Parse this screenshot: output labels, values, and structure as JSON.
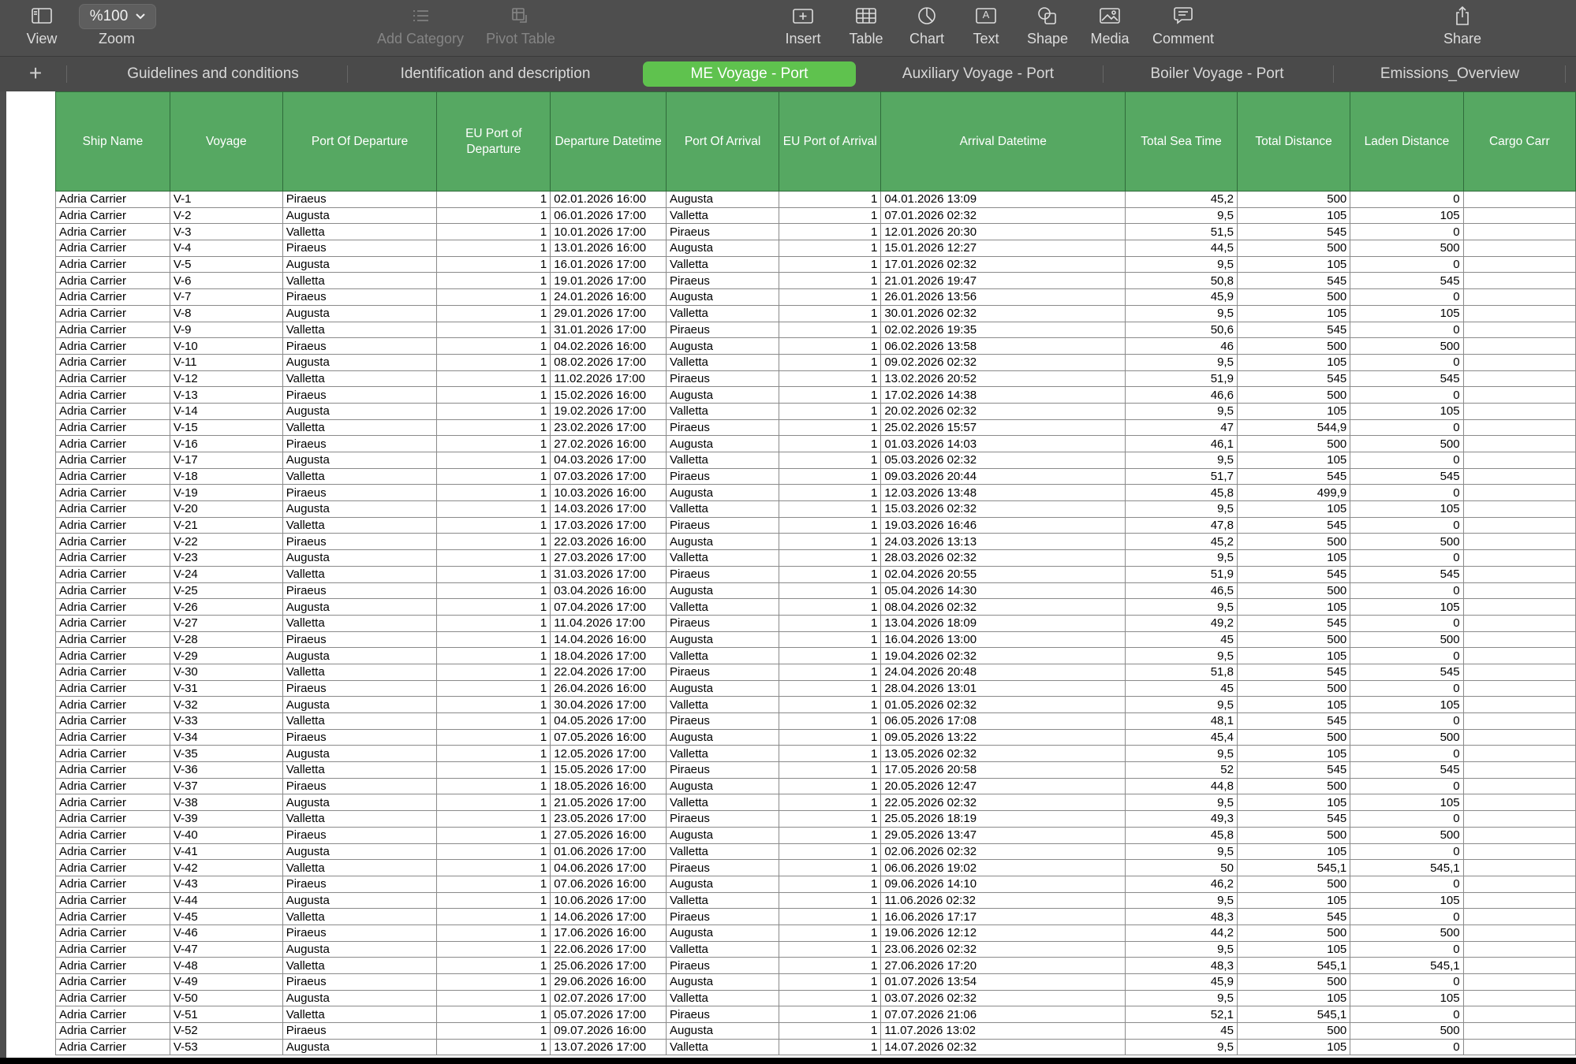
{
  "toolbar": {
    "view": "View",
    "zoom_label": "Zoom",
    "zoom_value": "%100",
    "add_category": "Add Category",
    "pivot_table": "Pivot Table",
    "insert": "Insert",
    "table": "Table",
    "chart": "Chart",
    "text": "Text",
    "text_icon_glyph": "A",
    "shape": "Shape",
    "media": "Media",
    "comment": "Comment",
    "share": "Share"
  },
  "tabs": [
    {
      "label": "Guidelines and conditions",
      "active": false
    },
    {
      "label": "Identification and description",
      "active": false
    },
    {
      "label": "ME Voyage - Port",
      "active": true
    },
    {
      "label": "Auxiliary Voyage - Port",
      "active": false
    },
    {
      "label": "Boiler Voyage - Port",
      "active": false
    },
    {
      "label": "Emissions_Overview",
      "active": false
    }
  ],
  "add_sheet": "+",
  "colors": {
    "header_green": "#56a862",
    "active_tab": "#5fc24e",
    "toolbar": "#4e4e4e"
  },
  "table": {
    "columns": [
      "Ship Name",
      "Voyage",
      "Port Of Departure",
      "EU Port of Departure",
      "Departure Datetime",
      "Port Of Arrival",
      "EU Port of Arrival",
      "Arrival Datetime",
      "Total Sea Time",
      "Total Distance",
      "Laden Distance",
      "Cargo Carr"
    ],
    "rows": [
      [
        "Adria Carrier",
        "V-1",
        "Piraeus",
        "1",
        "02.01.2026 16:00",
        "Augusta",
        "1",
        "04.01.2026 13:09",
        "45,2",
        "500",
        "0",
        ""
      ],
      [
        "Adria Carrier",
        "V-2",
        "Augusta",
        "1",
        "06.01.2026 17:00",
        "Valletta",
        "1",
        "07.01.2026 02:32",
        "9,5",
        "105",
        "105",
        ""
      ],
      [
        "Adria Carrier",
        "V-3",
        "Valletta",
        "1",
        "10.01.2026 17:00",
        "Piraeus",
        "1",
        "12.01.2026 20:30",
        "51,5",
        "545",
        "0",
        ""
      ],
      [
        "Adria Carrier",
        "V-4",
        "Piraeus",
        "1",
        "13.01.2026 16:00",
        "Augusta",
        "1",
        "15.01.2026 12:27",
        "44,5",
        "500",
        "500",
        ""
      ],
      [
        "Adria Carrier",
        "V-5",
        "Augusta",
        "1",
        "16.01.2026 17:00",
        "Valletta",
        "1",
        "17.01.2026 02:32",
        "9,5",
        "105",
        "0",
        ""
      ],
      [
        "Adria Carrier",
        "V-6",
        "Valletta",
        "1",
        "19.01.2026 17:00",
        "Piraeus",
        "1",
        "21.01.2026 19:47",
        "50,8",
        "545",
        "545",
        ""
      ],
      [
        "Adria Carrier",
        "V-7",
        "Piraeus",
        "1",
        "24.01.2026 16:00",
        "Augusta",
        "1",
        "26.01.2026 13:56",
        "45,9",
        "500",
        "0",
        ""
      ],
      [
        "Adria Carrier",
        "V-8",
        "Augusta",
        "1",
        "29.01.2026 17:00",
        "Valletta",
        "1",
        "30.01.2026 02:32",
        "9,5",
        "105",
        "105",
        ""
      ],
      [
        "Adria Carrier",
        "V-9",
        "Valletta",
        "1",
        "31.01.2026 17:00",
        "Piraeus",
        "1",
        "02.02.2026 19:35",
        "50,6",
        "545",
        "0",
        ""
      ],
      [
        "Adria Carrier",
        "V-10",
        "Piraeus",
        "1",
        "04.02.2026 16:00",
        "Augusta",
        "1",
        "06.02.2026 13:58",
        "46",
        "500",
        "500",
        ""
      ],
      [
        "Adria Carrier",
        "V-11",
        "Augusta",
        "1",
        "08.02.2026 17:00",
        "Valletta",
        "1",
        "09.02.2026 02:32",
        "9,5",
        "105",
        "0",
        ""
      ],
      [
        "Adria Carrier",
        "V-12",
        "Valletta",
        "1",
        "11.02.2026 17:00",
        "Piraeus",
        "1",
        "13.02.2026 20:52",
        "51,9",
        "545",
        "545",
        ""
      ],
      [
        "Adria Carrier",
        "V-13",
        "Piraeus",
        "1",
        "15.02.2026 16:00",
        "Augusta",
        "1",
        "17.02.2026 14:38",
        "46,6",
        "500",
        "0",
        ""
      ],
      [
        "Adria Carrier",
        "V-14",
        "Augusta",
        "1",
        "19.02.2026 17:00",
        "Valletta",
        "1",
        "20.02.2026 02:32",
        "9,5",
        "105",
        "105",
        ""
      ],
      [
        "Adria Carrier",
        "V-15",
        "Valletta",
        "1",
        "23.02.2026 17:00",
        "Piraeus",
        "1",
        "25.02.2026 15:57",
        "47",
        "544,9",
        "0",
        ""
      ],
      [
        "Adria Carrier",
        "V-16",
        "Piraeus",
        "1",
        "27.02.2026 16:00",
        "Augusta",
        "1",
        "01.03.2026 14:03",
        "46,1",
        "500",
        "500",
        ""
      ],
      [
        "Adria Carrier",
        "V-17",
        "Augusta",
        "1",
        "04.03.2026 17:00",
        "Valletta",
        "1",
        "05.03.2026 02:32",
        "9,5",
        "105",
        "0",
        ""
      ],
      [
        "Adria Carrier",
        "V-18",
        "Valletta",
        "1",
        "07.03.2026 17:00",
        "Piraeus",
        "1",
        "09.03.2026 20:44",
        "51,7",
        "545",
        "545",
        ""
      ],
      [
        "Adria Carrier",
        "V-19",
        "Piraeus",
        "1",
        "10.03.2026 16:00",
        "Augusta",
        "1",
        "12.03.2026 13:48",
        "45,8",
        "499,9",
        "0",
        ""
      ],
      [
        "Adria Carrier",
        "V-20",
        "Augusta",
        "1",
        "14.03.2026 17:00",
        "Valletta",
        "1",
        "15.03.2026 02:32",
        "9,5",
        "105",
        "105",
        ""
      ],
      [
        "Adria Carrier",
        "V-21",
        "Valletta",
        "1",
        "17.03.2026 17:00",
        "Piraeus",
        "1",
        "19.03.2026 16:46",
        "47,8",
        "545",
        "0",
        ""
      ],
      [
        "Adria Carrier",
        "V-22",
        "Piraeus",
        "1",
        "22.03.2026 16:00",
        "Augusta",
        "1",
        "24.03.2026 13:13",
        "45,2",
        "500",
        "500",
        ""
      ],
      [
        "Adria Carrier",
        "V-23",
        "Augusta",
        "1",
        "27.03.2026 17:00",
        "Valletta",
        "1",
        "28.03.2026 02:32",
        "9,5",
        "105",
        "0",
        ""
      ],
      [
        "Adria Carrier",
        "V-24",
        "Valletta",
        "1",
        "31.03.2026 17:00",
        "Piraeus",
        "1",
        "02.04.2026 20:55",
        "51,9",
        "545",
        "545",
        ""
      ],
      [
        "Adria Carrier",
        "V-25",
        "Piraeus",
        "1",
        "03.04.2026 16:00",
        "Augusta",
        "1",
        "05.04.2026 14:30",
        "46,5",
        "500",
        "0",
        ""
      ],
      [
        "Adria Carrier",
        "V-26",
        "Augusta",
        "1",
        "07.04.2026 17:00",
        "Valletta",
        "1",
        "08.04.2026 02:32",
        "9,5",
        "105",
        "105",
        ""
      ],
      [
        "Adria Carrier",
        "V-27",
        "Valletta",
        "1",
        "11.04.2026 17:00",
        "Piraeus",
        "1",
        "13.04.2026 18:09",
        "49,2",
        "545",
        "0",
        ""
      ],
      [
        "Adria Carrier",
        "V-28",
        "Piraeus",
        "1",
        "14.04.2026 16:00",
        "Augusta",
        "1",
        "16.04.2026 13:00",
        "45",
        "500",
        "500",
        ""
      ],
      [
        "Adria Carrier",
        "V-29",
        "Augusta",
        "1",
        "18.04.2026 17:00",
        "Valletta",
        "1",
        "19.04.2026 02:32",
        "9,5",
        "105",
        "0",
        ""
      ],
      [
        "Adria Carrier",
        "V-30",
        "Valletta",
        "1",
        "22.04.2026 17:00",
        "Piraeus",
        "1",
        "24.04.2026 20:48",
        "51,8",
        "545",
        "545",
        ""
      ],
      [
        "Adria Carrier",
        "V-31",
        "Piraeus",
        "1",
        "26.04.2026 16:00",
        "Augusta",
        "1",
        "28.04.2026 13:01",
        "45",
        "500",
        "0",
        ""
      ],
      [
        "Adria Carrier",
        "V-32",
        "Augusta",
        "1",
        "30.04.2026 17:00",
        "Valletta",
        "1",
        "01.05.2026 02:32",
        "9,5",
        "105",
        "105",
        ""
      ],
      [
        "Adria Carrier",
        "V-33",
        "Valletta",
        "1",
        "04.05.2026 17:00",
        "Piraeus",
        "1",
        "06.05.2026 17:08",
        "48,1",
        "545",
        "0",
        ""
      ],
      [
        "Adria Carrier",
        "V-34",
        "Piraeus",
        "1",
        "07.05.2026 16:00",
        "Augusta",
        "1",
        "09.05.2026 13:22",
        "45,4",
        "500",
        "500",
        ""
      ],
      [
        "Adria Carrier",
        "V-35",
        "Augusta",
        "1",
        "12.05.2026 17:00",
        "Valletta",
        "1",
        "13.05.2026 02:32",
        "9,5",
        "105",
        "0",
        ""
      ],
      [
        "Adria Carrier",
        "V-36",
        "Valletta",
        "1",
        "15.05.2026 17:00",
        "Piraeus",
        "1",
        "17.05.2026 20:58",
        "52",
        "545",
        "545",
        ""
      ],
      [
        "Adria Carrier",
        "V-37",
        "Piraeus",
        "1",
        "18.05.2026 16:00",
        "Augusta",
        "1",
        "20.05.2026 12:47",
        "44,8",
        "500",
        "0",
        ""
      ],
      [
        "Adria Carrier",
        "V-38",
        "Augusta",
        "1",
        "21.05.2026 17:00",
        "Valletta",
        "1",
        "22.05.2026 02:32",
        "9,5",
        "105",
        "105",
        ""
      ],
      [
        "Adria Carrier",
        "V-39",
        "Valletta",
        "1",
        "23.05.2026 17:00",
        "Piraeus",
        "1",
        "25.05.2026 18:19",
        "49,3",
        "545",
        "0",
        ""
      ],
      [
        "Adria Carrier",
        "V-40",
        "Piraeus",
        "1",
        "27.05.2026 16:00",
        "Augusta",
        "1",
        "29.05.2026 13:47",
        "45,8",
        "500",
        "500",
        ""
      ],
      [
        "Adria Carrier",
        "V-41",
        "Augusta",
        "1",
        "01.06.2026 17:00",
        "Valletta",
        "1",
        "02.06.2026 02:32",
        "9,5",
        "105",
        "0",
        ""
      ],
      [
        "Adria Carrier",
        "V-42",
        "Valletta",
        "1",
        "04.06.2026 17:00",
        "Piraeus",
        "1",
        "06.06.2026 19:02",
        "50",
        "545,1",
        "545,1",
        ""
      ],
      [
        "Adria Carrier",
        "V-43",
        "Piraeus",
        "1",
        "07.06.2026 16:00",
        "Augusta",
        "1",
        "09.06.2026 14:10",
        "46,2",
        "500",
        "0",
        ""
      ],
      [
        "Adria Carrier",
        "V-44",
        "Augusta",
        "1",
        "10.06.2026 17:00",
        "Valletta",
        "1",
        "11.06.2026 02:32",
        "9,5",
        "105",
        "105",
        ""
      ],
      [
        "Adria Carrier",
        "V-45",
        "Valletta",
        "1",
        "14.06.2026 17:00",
        "Piraeus",
        "1",
        "16.06.2026 17:17",
        "48,3",
        "545",
        "0",
        ""
      ],
      [
        "Adria Carrier",
        "V-46",
        "Piraeus",
        "1",
        "17.06.2026 16:00",
        "Augusta",
        "1",
        "19.06.2026 12:12",
        "44,2",
        "500",
        "500",
        ""
      ],
      [
        "Adria Carrier",
        "V-47",
        "Augusta",
        "1",
        "22.06.2026 17:00",
        "Valletta",
        "1",
        "23.06.2026 02:32",
        "9,5",
        "105",
        "0",
        ""
      ],
      [
        "Adria Carrier",
        "V-48",
        "Valletta",
        "1",
        "25.06.2026 17:00",
        "Piraeus",
        "1",
        "27.06.2026 17:20",
        "48,3",
        "545,1",
        "545,1",
        ""
      ],
      [
        "Adria Carrier",
        "V-49",
        "Piraeus",
        "1",
        "29.06.2026 16:00",
        "Augusta",
        "1",
        "01.07.2026 13:54",
        "45,9",
        "500",
        "0",
        ""
      ],
      [
        "Adria Carrier",
        "V-50",
        "Augusta",
        "1",
        "02.07.2026 17:00",
        "Valletta",
        "1",
        "03.07.2026 02:32",
        "9,5",
        "105",
        "105",
        ""
      ],
      [
        "Adria Carrier",
        "V-51",
        "Valletta",
        "1",
        "05.07.2026 17:00",
        "Piraeus",
        "1",
        "07.07.2026 21:06",
        "52,1",
        "545,1",
        "0",
        ""
      ],
      [
        "Adria Carrier",
        "V-52",
        "Piraeus",
        "1",
        "09.07.2026 16:00",
        "Augusta",
        "1",
        "11.07.2026 13:02",
        "45",
        "500",
        "500",
        ""
      ],
      [
        "Adria Carrier",
        "V-53",
        "Augusta",
        "1",
        "13.07.2026 17:00",
        "Valletta",
        "1",
        "14.07.2026 02:32",
        "9,5",
        "105",
        "0",
        ""
      ]
    ]
  }
}
